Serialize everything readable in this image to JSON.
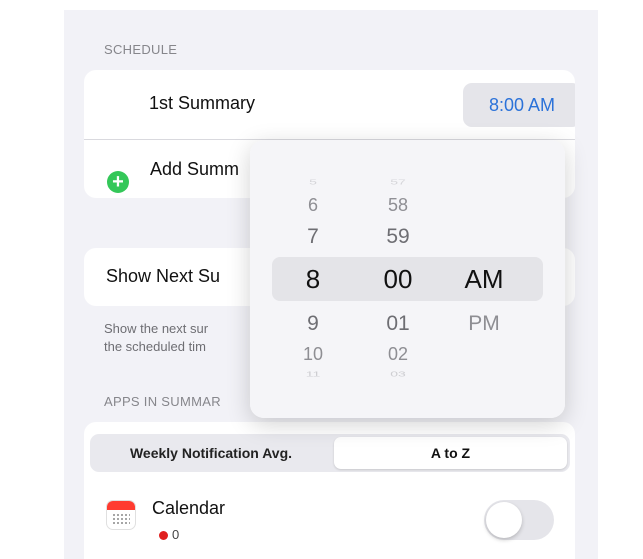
{
  "schedule": {
    "header": "SCHEDULE",
    "summary_label": "1st Summary",
    "summary_time": "8:00 AM",
    "add_label": "Add Summ"
  },
  "show_next": {
    "label": "Show Next Su",
    "description_line1": "Show the next sur",
    "description_line2": "the scheduled tim"
  },
  "apps": {
    "header": "APPS IN SUMMAR",
    "sort_options": [
      "Weekly Notification Avg.",
      "A to Z"
    ],
    "selected_sort": "A to Z",
    "items": [
      {
        "name": "Calendar",
        "count": "0",
        "enabled": false
      }
    ]
  },
  "picker": {
    "hours": [
      "5",
      "6",
      "7",
      "8",
      "9",
      "10",
      "11"
    ],
    "minutes": [
      "57",
      "58",
      "59",
      "00",
      "01",
      "02",
      "03"
    ],
    "periods": [
      "AM",
      "PM"
    ],
    "selected": {
      "hour": "8",
      "minute": "00",
      "period": "AM"
    }
  },
  "colors": {
    "accent": "#2b72d9",
    "add_green": "#34c759",
    "calendar_red": "#ff3b30"
  }
}
